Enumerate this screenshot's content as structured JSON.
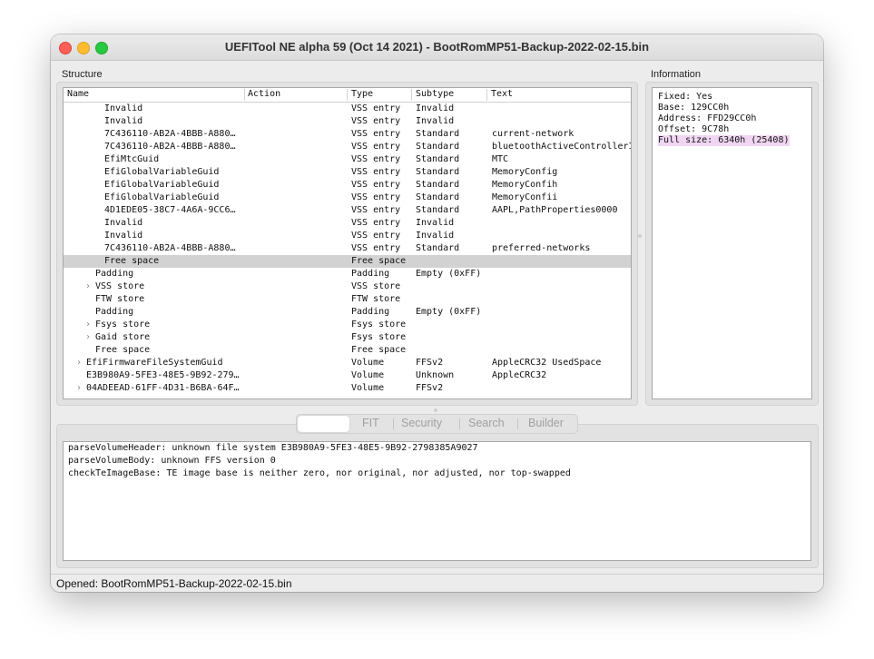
{
  "window": {
    "title": "UEFITool NE alpha 59 (Oct 14 2021) - BootRomMP51-Backup-2022-02-15.bin"
  },
  "structure": {
    "label": "Structure",
    "columns": {
      "name": "Name",
      "action": "Action",
      "type": "Type",
      "subtype": "Subtype",
      "text": "Text"
    },
    "rows": [
      {
        "name": "Invalid",
        "type": "VSS entry",
        "subtype": "Invalid",
        "text": ""
      },
      {
        "name": "Invalid",
        "type": "VSS entry",
        "subtype": "Invalid",
        "text": ""
      },
      {
        "name": "7C436110-AB2A-4BBB-A880…",
        "type": "VSS entry",
        "subtype": "Standard",
        "text": "current-network"
      },
      {
        "name": "7C436110-AB2A-4BBB-A880…",
        "type": "VSS entry",
        "subtype": "Standard",
        "text": "bluetoothActiveControllerI"
      },
      {
        "name": "EfiMtcGuid",
        "type": "VSS entry",
        "subtype": "Standard",
        "text": "MTC"
      },
      {
        "name": "EfiGlobalVariableGuid",
        "type": "VSS entry",
        "subtype": "Standard",
        "text": "MemoryConfig"
      },
      {
        "name": "EfiGlobalVariableGuid",
        "type": "VSS entry",
        "subtype": "Standard",
        "text": "MemoryConfih"
      },
      {
        "name": "EfiGlobalVariableGuid",
        "type": "VSS entry",
        "subtype": "Standard",
        "text": "MemoryConfii"
      },
      {
        "name": "4D1EDE05-38C7-4A6A-9CC6…",
        "type": "VSS entry",
        "subtype": "Standard",
        "text": "AAPL,PathProperties0000"
      },
      {
        "name": "Invalid",
        "type": "VSS entry",
        "subtype": "Invalid",
        "text": ""
      },
      {
        "name": "Invalid",
        "type": "VSS entry",
        "subtype": "Invalid",
        "text": ""
      },
      {
        "name": "7C436110-AB2A-4BBB-A880…",
        "type": "VSS entry",
        "subtype": "Standard",
        "text": "preferred-networks"
      },
      {
        "name": "Free space",
        "type": "Free space",
        "subtype": "",
        "text": ""
      },
      {
        "name": "Padding",
        "type": "Padding",
        "subtype": "Empty (0xFF)",
        "text": ""
      },
      {
        "name": "VSS store",
        "type": "VSS store",
        "subtype": "",
        "text": ""
      },
      {
        "name": "FTW store",
        "type": "FTW store",
        "subtype": "",
        "text": ""
      },
      {
        "name": "Padding",
        "type": "Padding",
        "subtype": "Empty (0xFF)",
        "text": ""
      },
      {
        "name": "Fsys store",
        "type": "Fsys store",
        "subtype": "",
        "text": ""
      },
      {
        "name": "Gaid store",
        "type": "Fsys store",
        "subtype": "",
        "text": ""
      },
      {
        "name": "Free space",
        "type": "Free space",
        "subtype": "",
        "text": ""
      },
      {
        "name": "EfiFirmwareFileSystemGuid",
        "type": "Volume",
        "subtype": "FFSv2",
        "text": "AppleCRC32 UsedSpace"
      },
      {
        "name": "E3B980A9-5FE3-48E5-9B92-279…",
        "type": "Volume",
        "subtype": "Unknown",
        "text": "AppleCRC32"
      },
      {
        "name": "04ADEEAD-61FF-4D31-B6BA-64F…",
        "type": "Volume",
        "subtype": "FFSv2",
        "text": ""
      }
    ]
  },
  "information": {
    "label": "Information",
    "fixed": "Fixed: Yes",
    "base": "Base: 129CC0h",
    "address": "Address: FFD29CC0h",
    "offset": "Offset: 9C78h",
    "full_size": "Full size: 6340h (25408)"
  },
  "tabs": {
    "t1": "",
    "t2": "FIT",
    "t3": "Security",
    "t4": "Search",
    "t5": "Builder"
  },
  "messages": [
    "parseVolumeHeader: unknown file system E3B980A9-5FE3-48E5-9B92-2798385A9027",
    "parseVolumeBody: unknown FFS version 0",
    "checkTeImageBase: TE image base is neither zero, nor original, nor adjusted, nor top-swapped"
  ],
  "status": {
    "text": "Opened: BootRomMP51-Backup-2022-02-15.bin"
  },
  "colors": {
    "selection": "#d2d2d2",
    "highlight": "#f0d6f2"
  }
}
